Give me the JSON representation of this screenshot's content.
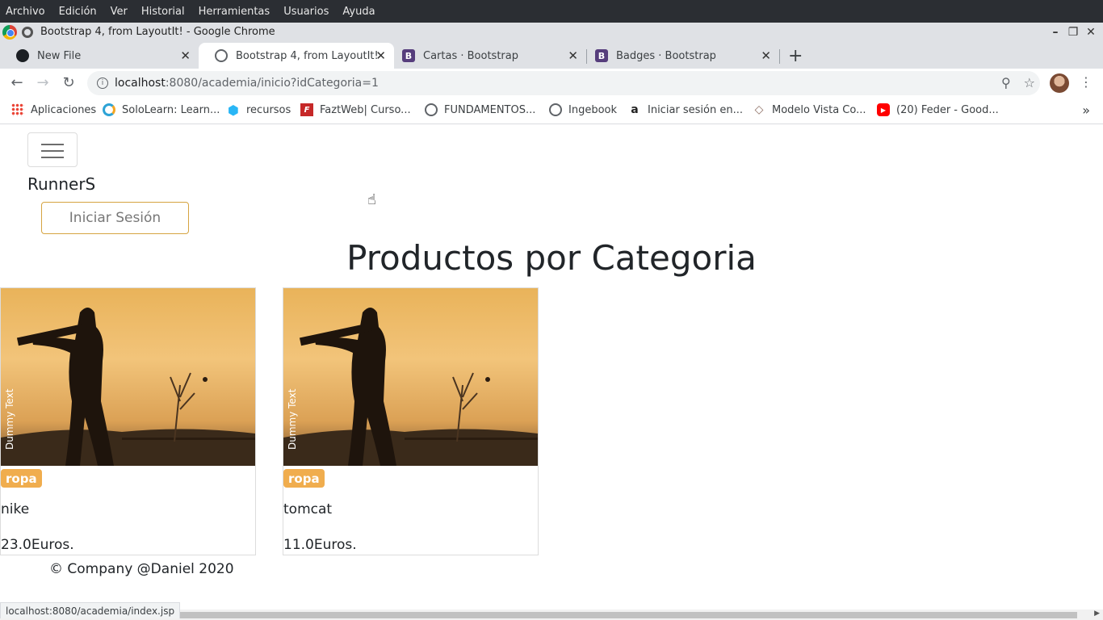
{
  "os_menu": [
    "Archivo",
    "Edición",
    "Ver",
    "Historial",
    "Herramientas",
    "Usuarios",
    "Ayuda"
  ],
  "window": {
    "title": "Bootstrap 4, from LayoutIt! - Google Chrome"
  },
  "tabs": [
    {
      "label": "New File",
      "icon": "github-icon"
    },
    {
      "label": "Bootstrap 4, from LayoutIt!",
      "icon": "globe-icon",
      "active": true
    },
    {
      "label": "Cartas · Bootstrap",
      "icon": "bootstrap-icon"
    },
    {
      "label": "Badges · Bootstrap",
      "icon": "bootstrap-icon"
    }
  ],
  "address": {
    "host": "localhost",
    "path": ":8080/academia/inicio?idCategoria=1"
  },
  "bookmarks": [
    {
      "label": "Aplicaciones",
      "icon": "apps-grid-icon"
    },
    {
      "label": "SoloLearn: Learn...",
      "icon": "sololearn-icon"
    },
    {
      "label": "recursos",
      "icon": "hexagon-icon"
    },
    {
      "label": "FaztWeb| Curso...",
      "icon": "faztweb-icon"
    },
    {
      "label": "FUNDAMENTOS...",
      "icon": "globe-icon"
    },
    {
      "label": "Ingebook",
      "icon": "globe-icon"
    },
    {
      "label": "Iniciar sesión en...",
      "icon": "amazon-icon"
    },
    {
      "label": "Modelo Vista Co...",
      "icon": "diamond-icon"
    },
    {
      "label": "(20) Feder - Good...",
      "icon": "youtube-icon"
    }
  ],
  "page": {
    "brand": "RunnerS",
    "login_button": "Iniciar Sesión",
    "title": "Productos por Categoria",
    "products": [
      {
        "badge": "ropa",
        "name": "nike",
        "price": "23.0Euros.",
        "image_text": "Dummy Text"
      },
      {
        "badge": "ropa",
        "name": "tomcat",
        "price": "11.0Euros.",
        "image_text": "Dummy Text"
      }
    ],
    "footer": "© Company @Daniel 2020"
  },
  "status_url": "localhost:8080/academia/index.jsp",
  "colors": {
    "badge": "#f0ad4e",
    "login_border": "#d6a441",
    "os_bar": "#2b2e33",
    "bootstrap_purple": "#563d7c"
  }
}
